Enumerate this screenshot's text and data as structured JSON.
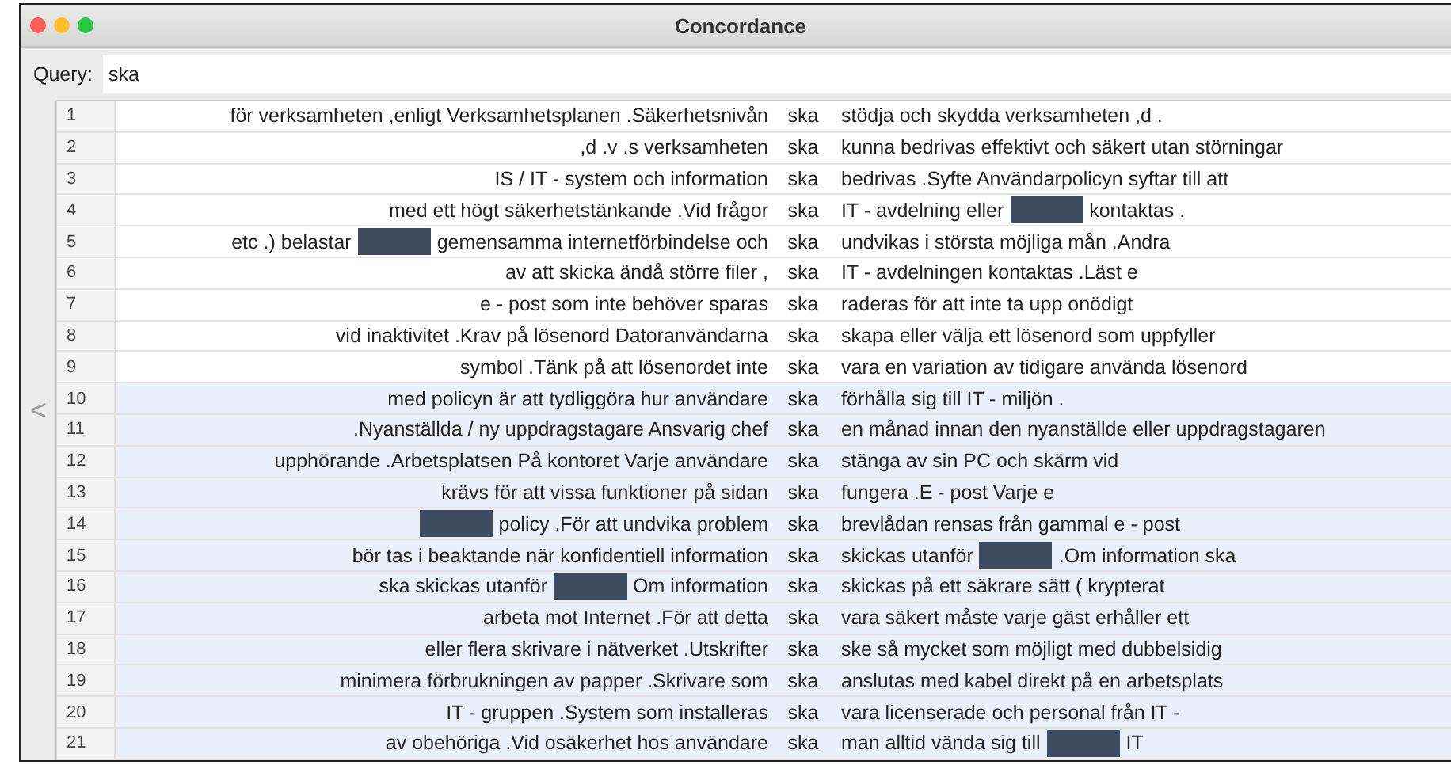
{
  "window": {
    "title": "Concordance"
  },
  "query": {
    "label": "Query:",
    "value": "ska"
  },
  "nav": {
    "back_symbol": "<"
  },
  "rows": [
    {
      "number": "1",
      "left": [
        {
          "kind": "text",
          "text": "för verksamheten ,enligt Verksamhetsplanen .Säkerhetsnivån"
        }
      ],
      "keyword": "ska",
      "right": [
        {
          "kind": "text",
          "text": "stödja och skydda verksamheten ,d ."
        }
      ],
      "selected": false
    },
    {
      "number": "2",
      "left": [
        {
          "kind": "text",
          "text": ",d .v .s verksamheten"
        }
      ],
      "keyword": "ska",
      "right": [
        {
          "kind": "text",
          "text": "kunna bedrivas effektivt och säkert utan störningar"
        }
      ],
      "selected": false
    },
    {
      "number": "3",
      "left": [
        {
          "kind": "text",
          "text": "IS / IT - system och information"
        }
      ],
      "keyword": "ska",
      "right": [
        {
          "kind": "text",
          "text": "bedrivas .Syfte Användarpolicyn syftar till att"
        }
      ],
      "selected": false
    },
    {
      "number": "4",
      "left": [
        {
          "kind": "text",
          "text": "med ett högt säkerhetstänkande .Vid frågor"
        }
      ],
      "keyword": "ska",
      "right": [
        {
          "kind": "text",
          "text": "IT - avdelning eller"
        },
        {
          "kind": "redacted"
        },
        {
          "kind": "text",
          "text": "kontaktas ."
        }
      ],
      "selected": false
    },
    {
      "number": "5",
      "left": [
        {
          "kind": "text",
          "text": "etc .) belastar"
        },
        {
          "kind": "redacted"
        },
        {
          "kind": "text",
          "text": "gemensamma internetförbindelse och"
        }
      ],
      "keyword": "ska",
      "right": [
        {
          "kind": "text",
          "text": "undvikas i största möjliga mån .Andra"
        }
      ],
      "selected": false
    },
    {
      "number": "6",
      "left": [
        {
          "kind": "text",
          "text": "av att skicka ändå större filer ,"
        }
      ],
      "keyword": "ska",
      "right": [
        {
          "kind": "text",
          "text": "IT - avdelningen kontaktas .Läst e"
        }
      ],
      "selected": false
    },
    {
      "number": "7",
      "left": [
        {
          "kind": "text",
          "text": "e - post som inte behöver sparas"
        }
      ],
      "keyword": "ska",
      "right": [
        {
          "kind": "text",
          "text": "raderas för att inte ta upp onödigt"
        }
      ],
      "selected": false
    },
    {
      "number": "8",
      "left": [
        {
          "kind": "text",
          "text": "vid inaktivitet .Krav på lösenord Datoranvändarna"
        }
      ],
      "keyword": "ska",
      "right": [
        {
          "kind": "text",
          "text": "skapa eller välja ett lösenord som uppfyller"
        }
      ],
      "selected": false
    },
    {
      "number": "9",
      "left": [
        {
          "kind": "text",
          "text": "symbol .Tänk på att lösenordet inte"
        }
      ],
      "keyword": "ska",
      "right": [
        {
          "kind": "text",
          "text": "vara en variation av tidigare använda lösenord"
        }
      ],
      "selected": false
    },
    {
      "number": "10",
      "left": [
        {
          "kind": "text",
          "text": "med policyn är att tydliggöra hur användare"
        }
      ],
      "keyword": "ska",
      "right": [
        {
          "kind": "text",
          "text": "förhålla sig till IT - miljön ."
        }
      ],
      "selected": true
    },
    {
      "number": "11",
      "left": [
        {
          "kind": "text",
          "text": ".Nyanställda / ny uppdragstagare Ansvarig chef"
        }
      ],
      "keyword": "ska",
      "right": [
        {
          "kind": "text",
          "text": "en månad innan den nyanställde eller uppdragstagaren"
        }
      ],
      "selected": true
    },
    {
      "number": "12",
      "left": [
        {
          "kind": "text",
          "text": "upphörande .Arbetsplatsen På kontoret Varje användare"
        }
      ],
      "keyword": "ska",
      "right": [
        {
          "kind": "text",
          "text": "stänga av sin PC och skärm vid"
        }
      ],
      "selected": true
    },
    {
      "number": "13",
      "left": [
        {
          "kind": "text",
          "text": "krävs för att vissa funktioner på sidan"
        }
      ],
      "keyword": "ska",
      "right": [
        {
          "kind": "text",
          "text": "fungera .E - post Varje e"
        }
      ],
      "selected": true
    },
    {
      "number": "14",
      "left": [
        {
          "kind": "redacted"
        },
        {
          "kind": "text",
          "text": "policy .För att undvika problem"
        }
      ],
      "keyword": "ska",
      "right": [
        {
          "kind": "text",
          "text": "brevlådan rensas från gammal e - post"
        }
      ],
      "selected": true
    },
    {
      "number": "15",
      "left": [
        {
          "kind": "text",
          "text": "bör tas i beaktande när konfidentiell information"
        }
      ],
      "keyword": "ska",
      "right": [
        {
          "kind": "text",
          "text": "skickas utanför"
        },
        {
          "kind": "redacted"
        },
        {
          "kind": "text",
          "text": ".Om information ska"
        }
      ],
      "selected": true
    },
    {
      "number": "16",
      "left": [
        {
          "kind": "text",
          "text": "ska skickas utanför"
        },
        {
          "kind": "redacted"
        },
        {
          "kind": "text",
          "text": "Om information"
        }
      ],
      "keyword": "ska",
      "right": [
        {
          "kind": "text",
          "text": "skickas på ett säkrare sätt ( krypterat"
        }
      ],
      "selected": true
    },
    {
      "number": "17",
      "left": [
        {
          "kind": "text",
          "text": "arbeta mot Internet .För att detta"
        }
      ],
      "keyword": "ska",
      "right": [
        {
          "kind": "text",
          "text": "vara säkert måste varje gäst erhåller ett"
        }
      ],
      "selected": true
    },
    {
      "number": "18",
      "left": [
        {
          "kind": "text",
          "text": "eller flera skrivare i nätverket .Utskrifter"
        }
      ],
      "keyword": "ska",
      "right": [
        {
          "kind": "text",
          "text": "ske så mycket som möjligt med dubbelsidig"
        }
      ],
      "selected": true
    },
    {
      "number": "19",
      "left": [
        {
          "kind": "text",
          "text": "minimera förbrukningen av papper .Skrivare som"
        }
      ],
      "keyword": "ska",
      "right": [
        {
          "kind": "text",
          "text": "anslutas med kabel direkt på en arbetsplats"
        }
      ],
      "selected": true
    },
    {
      "number": "20",
      "left": [
        {
          "kind": "text",
          "text": "IT - gruppen .System som installeras"
        }
      ],
      "keyword": "ska",
      "right": [
        {
          "kind": "text",
          "text": "vara licenserade och personal från IT -"
        }
      ],
      "selected": true
    },
    {
      "number": "21",
      "left": [
        {
          "kind": "text",
          "text": "av obehöriga .Vid osäkerhet hos användare"
        }
      ],
      "keyword": "ska",
      "right": [
        {
          "kind": "text",
          "text": "man alltid vända sig till"
        },
        {
          "kind": "redacted"
        },
        {
          "kind": "text",
          "text": "IT"
        }
      ],
      "selected": true
    }
  ]
}
